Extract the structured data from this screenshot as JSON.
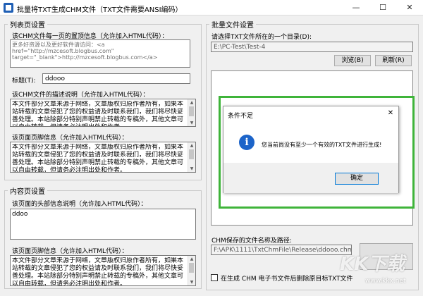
{
  "window": {
    "title": "批量将TXT生成CHM文件（TXT文件需要ANSI编码）",
    "minimize_glyph": "—",
    "maximize_glyph": "☐",
    "close_glyph": "✕"
  },
  "list_page": {
    "group_title": "列表页设置",
    "ad_label": "该CHM文件每一页的置顶信息（允许加入HTML代码）：",
    "ad_value": "更多好资源以及更好软件请访问：<a href=\"http://mzcesoft.blogbus.com\" target=\"_blank\">http://mzcesoft.blogbus.com</a>",
    "title_label": "标题(T):",
    "title_value": "ddooo",
    "desc_label": "该CHM文件的描述说明（允许加入HTML代码）：",
    "desc_value": "本文件部分文章来源于网络，文章版权归原作者所有，如果本站转载的文章侵犯了您的权益请及时联系我们，我们将尽快妥善处理。本站除部分特别声明禁止转载的专稿外，其他文章可以自由转载，但请务必注明出处和作者。",
    "footer_label": "该页面页脚信息（允许加入HTML代码）：",
    "footer_value": "本文件部分文章来源于网络，文章版权归原作者所有，如果本站转载的文章侵犯了您的权益请及时联系我们，我们将尽快妥善处理。本站除部分特别声明禁止转载的专稿外，其他文章可以自由转载，但请务必注明出处和作者。"
  },
  "content_page": {
    "group_title": "内容页设置",
    "header_label": "该页面的头部信息说明（允许加入HTML代码）：",
    "header_value": "ddoo",
    "footer_label": "该页面页脚信息（允许加入HTML代码）：",
    "footer_value": "本文件部分文章来源于网络，文章版权归原作者所有，如果本站转载的文章侵犯了您的权益请及时联系我们，我们将尽快妥善处理。本站除部分特别声明禁止转载的专稿外，其他文章可以自由转载，但请务必注明出处和作者。"
  },
  "batch": {
    "group_title": "批量文件设置",
    "dir_label": "请选择TXT文件所在的一个目录(D):",
    "dir_value": "E:\\PC-Test\\Test-4",
    "browse_label": "浏览(B)",
    "refresh_label": "刷新(R)",
    "chm_label": "CHM保存的文件名称及路径:",
    "chm_value": "F:\\APK\\1111\\TxtChmFile\\Release\\ddooo.chm",
    "delete_label": "在生成 CHM 电子书文件后删除原目标TXT文件"
  },
  "dialog": {
    "title": "条件不足",
    "close_glyph": "✕",
    "icon_glyph": "i",
    "message": "您当前尚没有至少一个有效的TXT文件进行生成!",
    "ok_label": "确定"
  },
  "watermark": {
    "logo": "KK下载",
    "url": "www.kkx.net"
  },
  "colors": {
    "highlight_frame": "#3fb43a",
    "info_icon": "#1c64c9",
    "button_focus": "#0078d7"
  }
}
